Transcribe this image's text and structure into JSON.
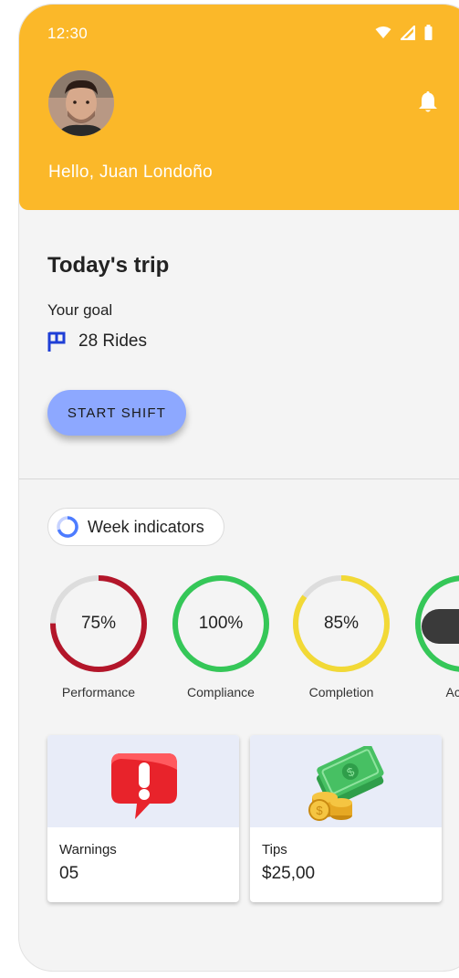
{
  "status_bar": {
    "time": "12:30"
  },
  "header": {
    "greeting": "Hello, Juan Londoño"
  },
  "trip": {
    "title": "Today's trip",
    "goal_label": "Your goal",
    "goal_value": "28 Rides",
    "start_button": "START SHIFT"
  },
  "indicators": {
    "chip_label": "Week indicators",
    "items": [
      {
        "value_text": "75%",
        "label": "Performance",
        "percent": 75,
        "color": "#b3162a"
      },
      {
        "value_text": "100%",
        "label": "Compliance",
        "percent": 100,
        "color": "#35c758"
      },
      {
        "value_text": "85%",
        "label": "Completion",
        "percent": 85,
        "color": "#f2d936"
      },
      {
        "value_text": "",
        "label": "Accep",
        "percent": 100,
        "color": "#35c758"
      }
    ]
  },
  "cards": [
    {
      "label": "Warnings",
      "value": "05",
      "icon": "warning-bubble-icon"
    },
    {
      "label": "Tips",
      "value": "$25,00",
      "icon": "money-coins-icon"
    }
  ],
  "colors": {
    "header": "#fbb829",
    "button": "#8da8ff",
    "flag": "#1f3fd6",
    "background": "#f4f4f4"
  }
}
